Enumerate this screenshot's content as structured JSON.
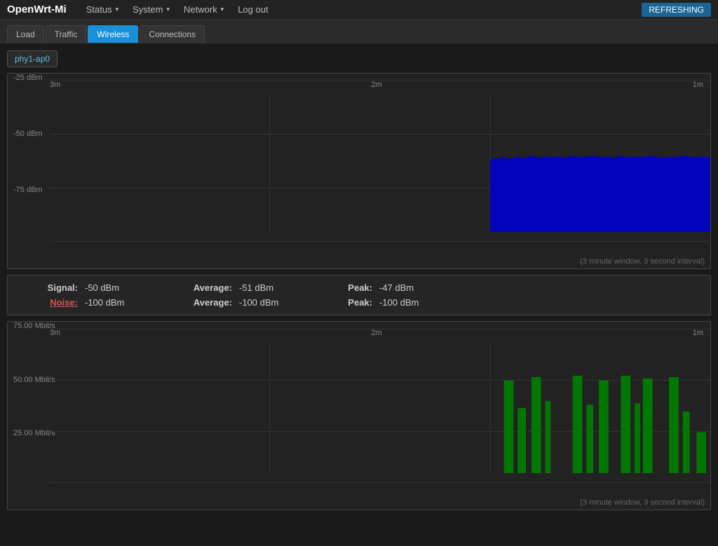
{
  "header": {
    "brand": "OpenWrt-Mi",
    "nav": [
      {
        "label": "Status",
        "has_dropdown": true
      },
      {
        "label": "System",
        "has_dropdown": true
      },
      {
        "label": "Network",
        "has_dropdown": true
      },
      {
        "label": "Log out",
        "has_dropdown": false
      }
    ],
    "refresh_button": "REFRESHING"
  },
  "tabs": [
    {
      "label": "Load",
      "active": false
    },
    {
      "label": "Traffic",
      "active": false
    },
    {
      "label": "Wireless",
      "active": true
    },
    {
      "label": "Connections",
      "active": false
    }
  ],
  "interface_tab": "phy1-ap0",
  "signal_chart": {
    "footer": "(3 minute window, 3 second interval)",
    "x_labels": [
      "3m",
      "2m",
      "1m"
    ],
    "y_labels": [
      "-25 dBm",
      "-50 dBm",
      "-75 dBm"
    ]
  },
  "stats": {
    "signal_label": "Signal:",
    "signal_value": "-50 dBm",
    "signal_avg_label": "Average:",
    "signal_avg_value": "-51 dBm",
    "signal_peak_label": "Peak:",
    "signal_peak_value": "-47 dBm",
    "noise_label": "Noise:",
    "noise_value": "-100 dBm",
    "noise_avg_label": "Average:",
    "noise_avg_value": "-100 dBm",
    "noise_peak_label": "Peak:",
    "noise_peak_value": "-100 dBm"
  },
  "bitrate_chart": {
    "footer": "(3 minute window, 3 second interval)",
    "x_labels": [
      "3m",
      "2m",
      "1m"
    ],
    "y_labels": [
      "75.00 Mbit/s",
      "50.00 Mbit/s",
      "25.00 Mbit/s"
    ]
  }
}
